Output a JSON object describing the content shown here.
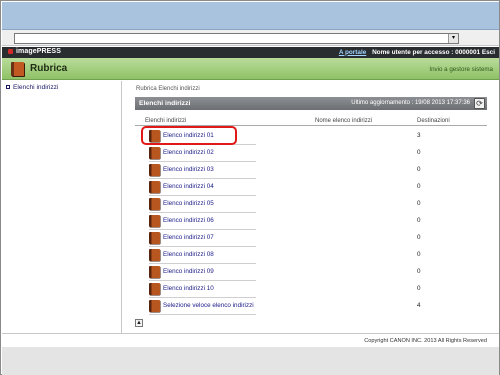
{
  "header": {
    "brand": "imagePRESS",
    "portal_link": "A portale",
    "user_label": "Nome utente per accesso : 0000001",
    "logout": "Esci"
  },
  "app": {
    "title": "Rubrica",
    "send_link": "Invio a gestore sistema"
  },
  "sidebar": {
    "items": [
      {
        "label": "Elenchi indirizzi"
      }
    ]
  },
  "main": {
    "breadcrumb": "Rubrica  Elenchi indirizzi",
    "panel_title": "Elenchi indirizzi",
    "last_update": "Ultimo aggiornamento : 19/08 2013 17:37:36",
    "columns": [
      "Elenchi indirizzi",
      "Nome elenco indirizzi",
      "Destinazioni"
    ],
    "rows": [
      {
        "name": "Elenco indirizzi 01",
        "dest": "3",
        "highlighted": true
      },
      {
        "name": "Elenco indirizzi 02",
        "dest": "0"
      },
      {
        "name": "Elenco indirizzi 03",
        "dest": "0"
      },
      {
        "name": "Elenco indirizzi 04",
        "dest": "0"
      },
      {
        "name": "Elenco indirizzi 05",
        "dest": "0"
      },
      {
        "name": "Elenco indirizzi 06",
        "dest": "0"
      },
      {
        "name": "Elenco indirizzi 07",
        "dest": "0"
      },
      {
        "name": "Elenco indirizzi 08",
        "dest": "0"
      },
      {
        "name": "Elenco indirizzi 09",
        "dest": "0"
      },
      {
        "name": "Elenco indirizzi 10",
        "dest": "0"
      },
      {
        "name": "Selezione veloce elenco indirizzi",
        "dest": "4"
      }
    ]
  },
  "footer": {
    "copyright": "Copyright CANON INC. 2013 All Rights Reserved"
  },
  "colors": {
    "header_dark": "#2a2d30",
    "header_green": "#a6d07f",
    "link": "#1a1a88",
    "highlight": "#e01818",
    "icon_brown": "#b8561f"
  },
  "icons": {
    "book": "address-book-icon",
    "refresh": "refresh-icon",
    "top": "page-top-icon"
  }
}
